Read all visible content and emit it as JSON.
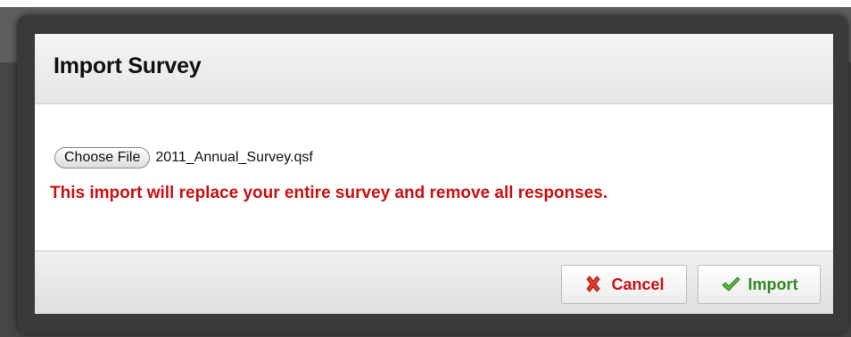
{
  "dialog": {
    "title": "Import Survey"
  },
  "file_input": {
    "button_label": "Choose File",
    "selected_file": "2011_Annual_Survey.qsf"
  },
  "warning": {
    "text": "This import will replace your entire survey and remove all responses.",
    "color": "#cc1111"
  },
  "footer": {
    "cancel_label": "Cancel",
    "cancel_icon": "red-x-icon",
    "import_label": "Import",
    "import_icon": "green-checkmark-icon",
    "import_color": "#2e8b1e"
  }
}
